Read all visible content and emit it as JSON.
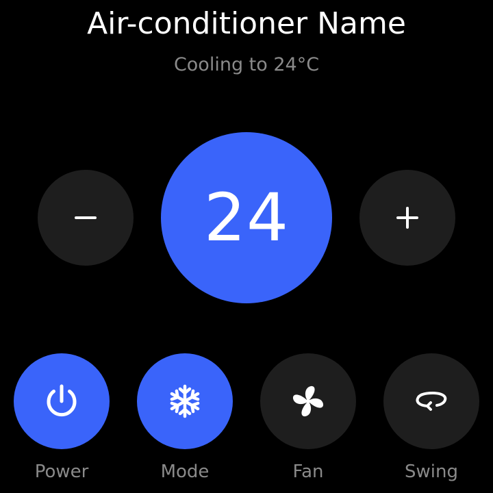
{
  "device": {
    "name": "Air-conditioner Name",
    "status": "Cooling to 24°C"
  },
  "thermostat": {
    "target_temperature": "24",
    "decrease_label": "−",
    "increase_label": "+"
  },
  "controls": [
    {
      "label": "Power",
      "icon": "power-icon",
      "active": true
    },
    {
      "label": "Mode",
      "icon": "snowflake-icon",
      "active": true
    },
    {
      "label": "Fan",
      "icon": "fan-icon",
      "active": false
    },
    {
      "label": "Swing",
      "icon": "swing-icon",
      "active": false
    }
  ],
  "colors": {
    "accent": "#3a64fa",
    "inactive": "#1e1e1e",
    "background": "#000000",
    "secondary_text": "#8a8a8a"
  }
}
